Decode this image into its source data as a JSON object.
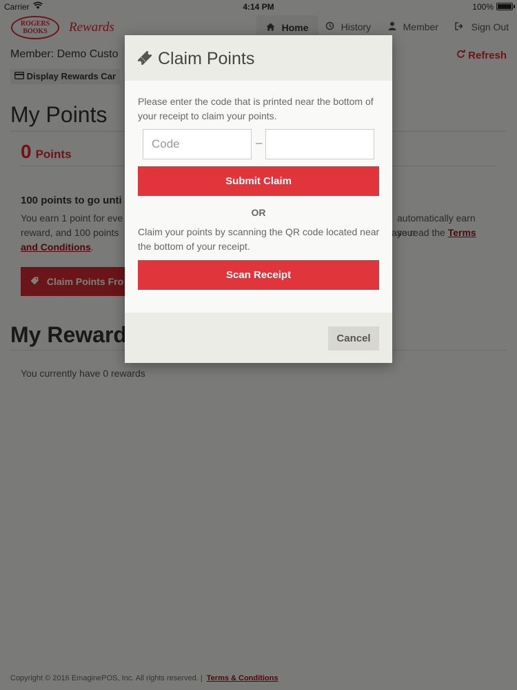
{
  "status_bar": {
    "carrier": "Carrier",
    "time": "4:14 PM",
    "battery": "100%"
  },
  "navbar": {
    "logo_text": "ROGERS BOOKS",
    "brand_word": "Rewards",
    "items": [
      {
        "label": "Home",
        "icon": "home-icon",
        "active": true
      },
      {
        "label": "History",
        "icon": "history-icon",
        "active": false
      },
      {
        "label": "Member",
        "icon": "user-icon",
        "active": false
      },
      {
        "label": "Sign Out",
        "icon": "sign-out-icon",
        "active": false
      }
    ]
  },
  "page": {
    "member_label": "Member: Demo Custo",
    "refresh_label": "Refresh",
    "display_card_label": "Display Rewards Car",
    "points_heading": "My Points",
    "points_value": "0",
    "points_unit": "Points",
    "to_go_text": "100 points to go unti",
    "earn_text_start": "You earn 1 point for eve",
    "earn_text_right": "automatically earn your",
    "earn_text_line2_start": "reward, and 100 points",
    "earn_text_line2_right": "ase read the",
    "terms_link": "Terms",
    "terms_link_line2": "and Conditions",
    "period": ".",
    "claim_button": "Claim Points Fro",
    "rewards_heading": "My Rewards",
    "rewards_empty": "You currently have 0 rewards"
  },
  "footer": {
    "copyright": "Copyright © 2016 EmaginePOS, Inc.  All rights reserved.  |",
    "terms_link": "Terms & Conditions"
  },
  "modal": {
    "title": "Claim Points",
    "instruction_code": "Please enter the code that is printed near the bottom of your receipt to claim your points.",
    "code_placeholder": "Code",
    "code_value": "",
    "code2_placeholder": "",
    "code2_value": "",
    "separator": "–",
    "submit_label": "Submit Claim",
    "or_label": "OR",
    "instruction_scan": "Claim your points by scanning the QR code located near the bottom of your receipt.",
    "scan_label": "Scan Receipt",
    "cancel_label": "Cancel"
  },
  "colors": {
    "accent": "#d42a2f",
    "button_red": "#e0353a",
    "link": "#a01016"
  }
}
